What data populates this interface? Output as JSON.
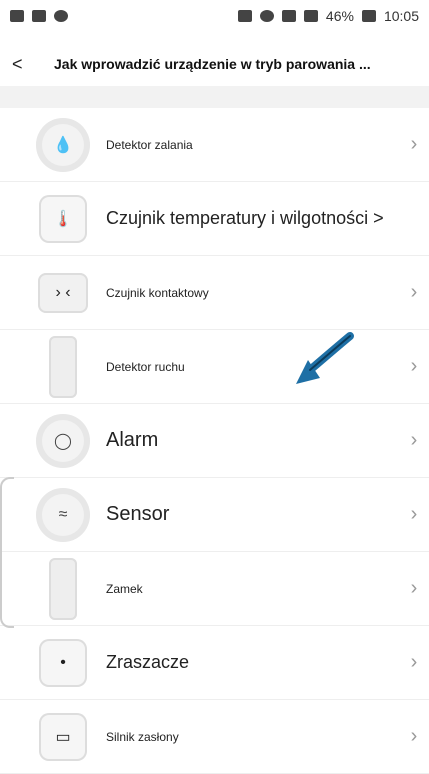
{
  "status": {
    "battery_text": "46%",
    "time": "10:05"
  },
  "header": {
    "back_label": "<",
    "title": "Jak wprowadzić urządzenie w tryb parowania ..."
  },
  "items": [
    {
      "label": "Detektor zalania",
      "icon": "water-drop-icon"
    },
    {
      "label": "Czujnik temperatury i wilgotności >",
      "icon": "thermometer-icon"
    },
    {
      "label": "Czujnik kontaktowy",
      "icon": "contact-sensor-icon"
    },
    {
      "label": "Detektor ruchu",
      "icon": "motion-sensor-icon"
    },
    {
      "label": "Alarm",
      "icon": "alarm-icon"
    },
    {
      "label": "Sensor",
      "icon": "sensor-waves-icon"
    },
    {
      "label": "Zamek",
      "icon": "lock-icon"
    },
    {
      "label": "Zraszacze",
      "icon": "sprinkler-icon"
    },
    {
      "label": "Silnik zasłony",
      "icon": "curtain-motor-icon"
    }
  ],
  "colors": {
    "accent_blue": "#1e6fa5"
  }
}
